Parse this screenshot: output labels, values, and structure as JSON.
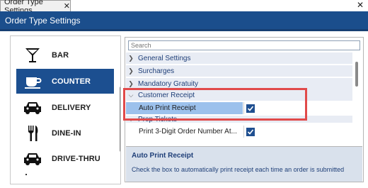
{
  "tab": {
    "title": "Order Type Settings",
    "close": "✕"
  },
  "window": {
    "close": "✕"
  },
  "header": {
    "title": "Order Type Settings"
  },
  "order_types": [
    {
      "label": "BAR",
      "icon": "cocktail-glass-icon"
    },
    {
      "label": "COUNTER",
      "icon": "coffee-cup-icon",
      "selected": true
    },
    {
      "label": "DELIVERY",
      "icon": "car-icon"
    },
    {
      "label": "DINE-IN",
      "icon": "fork-knife-icon"
    },
    {
      "label": "DRIVE-THRU",
      "icon": "car-icon"
    }
  ],
  "settings": {
    "search_placeholder": "Search",
    "categories": {
      "general": "General Settings",
      "surcharges": "Surcharges",
      "gratuity": "Mandatory Gratuity",
      "receipt": "Customer Receipt",
      "prep": "Prep Tickets"
    },
    "properties": {
      "auto_print": "Auto Print Receipt",
      "print_digit": "Print 3-Digit Order Number At..."
    },
    "values": {
      "auto_print": true,
      "print_digit": true
    }
  },
  "description": {
    "title": "Auto Print Receipt",
    "text": "Check the box to automatically print receipt each time an order is submitted"
  },
  "colors": {
    "header": "#1b4e8c",
    "selected": "#1c4f90",
    "highlight": "#e14a4a"
  }
}
